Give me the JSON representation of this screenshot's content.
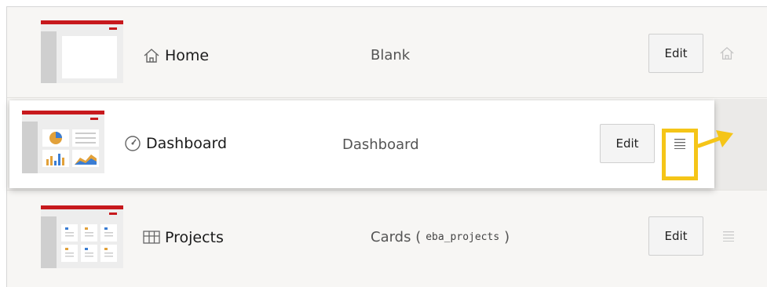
{
  "rows": [
    {
      "label": "Home",
      "type": "Blank",
      "edit": "Edit",
      "label_icon": "home-icon",
      "trailing_icon": "home-icon"
    },
    {
      "label": "Dashboard",
      "type": "Dashboard",
      "edit": "Edit",
      "label_icon": "dashboard-gauge-icon",
      "trailing_icon": "drag-handle-icon"
    },
    {
      "label": "Projects",
      "type_prefix": "Cards (",
      "type_code": "eba_projects",
      "type_suffix": ")",
      "edit": "Edit",
      "label_icon": "table-grid-icon",
      "trailing_icon": "drag-handle-icon"
    }
  ],
  "colors": {
    "brand_red": "#c7191d",
    "highlight": "#f5c518",
    "background": "#f7f6f4"
  }
}
